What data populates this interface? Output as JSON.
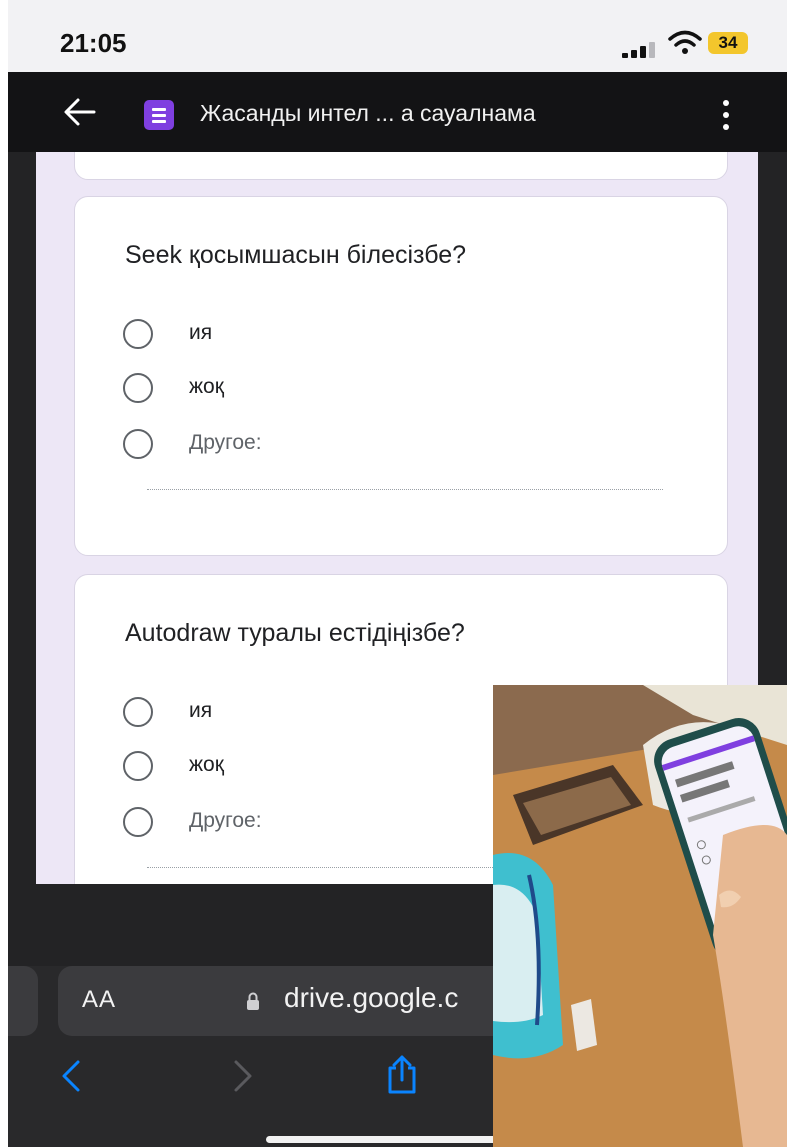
{
  "status_bar": {
    "time": "21:05",
    "battery": "34"
  },
  "app_bar": {
    "title": "Жасанды интел ... а сауалнама",
    "icons": [
      "back-arrow-icon",
      "forms-icon",
      "more-vert-icon"
    ]
  },
  "form": {
    "questions": [
      {
        "text": "Seek қосымшасын білесізбе?",
        "options": [
          "ия",
          "жоқ",
          "Другое:"
        ]
      },
      {
        "text": "Autodraw туралы естідіңізбе?",
        "options": [
          "ия",
          "жоқ",
          "Другое:"
        ]
      }
    ]
  },
  "browser": {
    "text_size_label": "AA",
    "url": "drive.google.c",
    "icons": [
      "lock-icon",
      "back-chevron-icon",
      "forward-chevron-icon",
      "share-icon"
    ]
  },
  "colors": {
    "form_background": "#ede7f6",
    "forms_brand": "#7f3fe0",
    "link_blue": "#0a84ff",
    "battery": "#f3c62c"
  }
}
